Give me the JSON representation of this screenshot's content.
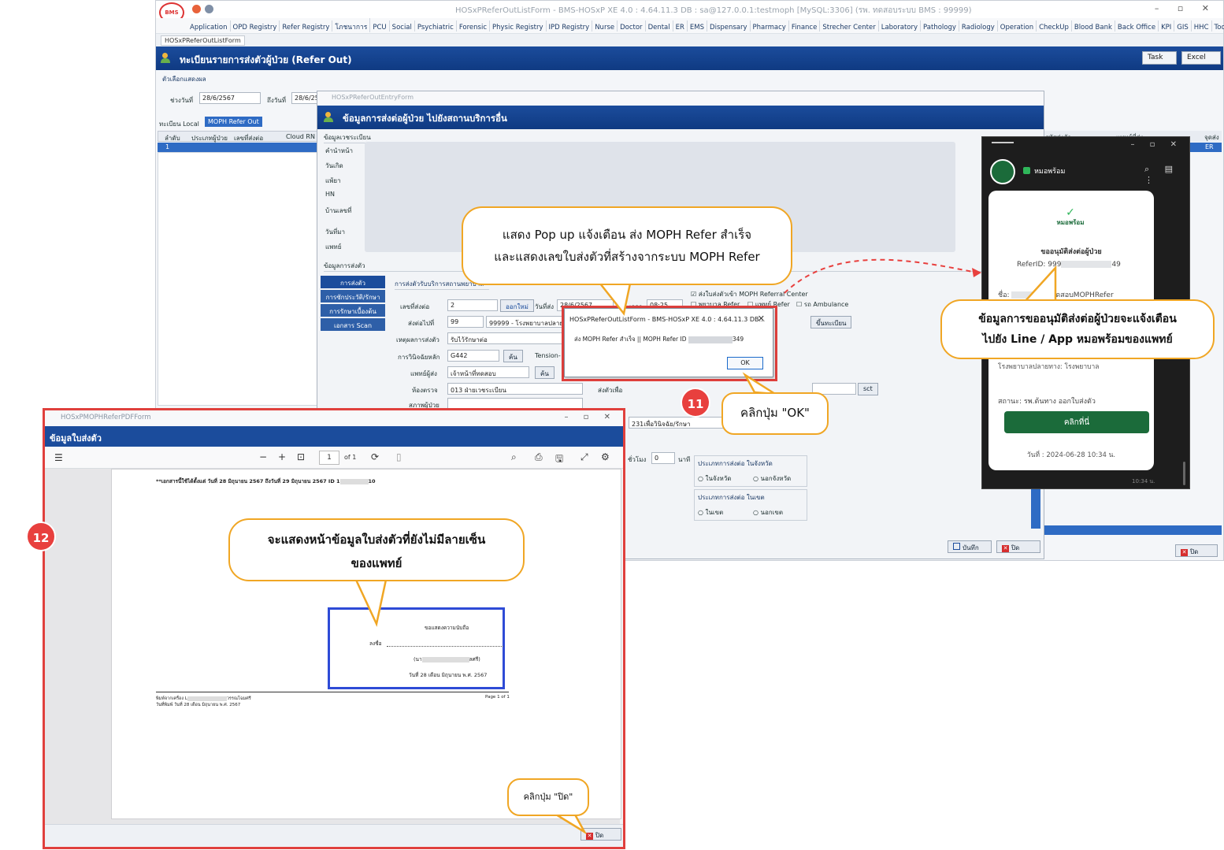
{
  "main_window": {
    "title": "HOSxPReferOutListForm - BMS-HOSxP XE 4.0 : 4.64.11.3 DB : sa@127.0.0.1:testmoph [MySQL:3306] (รพ. ทดสอบระบบ BMS : 99999)",
    "window_controls": "– ▫ ✕",
    "menu": [
      "Application",
      "OPD Registry",
      "Refer Registry",
      "โภชนาการ",
      "PCU",
      "Social",
      "Psychiatric",
      "Forensic",
      "Physic Registry",
      "IPD Registry",
      "Nurse",
      "Doctor",
      "Dental",
      "ER",
      "EMS",
      "Dispensary",
      "Pharmacy",
      "Finance",
      "Strecher Center",
      "Laboratory",
      "Pathology",
      "Radiology",
      "Operation",
      "CheckUp",
      "Blood Bank",
      "Back Office",
      "KPI",
      "GIS",
      "HHC",
      "Tools"
    ],
    "doc_tab": "HOSxPReferOutListForm",
    "header_title": "ทะเบียนรายการส่งตัวผู้ป่วย (Refer Out)",
    "task_button": "Task",
    "excel_button": "Excel",
    "filter_label": "ตัวเลือกแสดงผล",
    "date_from_label": "ช่วงวันที่",
    "date_from_value": "28/6/2567",
    "date_to_label": "ถึงวันที่",
    "date_to_value": "28/6/25",
    "tabs": [
      "ทะเบียน Local",
      "MOPH Refer Out"
    ],
    "grid_headers": [
      "ลำดับ",
      "ประเภทผู้ป่วย",
      "เลขที่ส่งต่อ",
      "Cloud RN"
    ],
    "grid_row_index": "1",
    "right_grid_headers": [
      "รหัสส่งตัว",
      "แพทย์ที่ส่ง",
      "จุดส่ง"
    ],
    "right_grid_value": "ER",
    "close_button": "ปิด"
  },
  "entry_window": {
    "title": "HOSxPReferOutEntryForm",
    "header_title": "ข้อมูลการส่งต่อผู้ป่วย ไปยังสถานบริการอื่น",
    "patient_section": "ข้อมูลเวชระเบียน",
    "patient_labels": [
      "คำนำหน้า",
      "วันเกิด",
      "แพ้ยา",
      "HN",
      "บ้านเลขที่",
      "วันที่มา",
      "แพทย์"
    ],
    "refer_section": "ข้อมูลการส่งตัว",
    "side_tabs": [
      "การส่งตัว",
      "การซักประวัติ/รักษา",
      "การรักษาเบื้องต้น",
      "เอกสาร Scan"
    ],
    "sub_section": "การส่งตัวรับบริการสถานพยาบาล",
    "refer_no_label": "เลขที่ส่งต่อ",
    "refer_no_value": "2",
    "new_button": "ออกใหม่",
    "send_date_label": "วันที่ส่ง",
    "send_date_value": "28/6/2567",
    "time_label": "เวลา",
    "time_value": "08:25",
    "dest_label": "ส่งต่อไปที่",
    "dest_code": "99",
    "dest_name": "99999 - โรงพยาบาลปลายทาง",
    "register_button": "ขึ้นทะเบียน",
    "reason_label": "เหตุผลการส่งตัว",
    "reason_value": "รับไว้รักษาต่อ",
    "dx_label": "การวินิจฉัยหลัก",
    "dx_value": "G442",
    "search_button": "ค้น",
    "dx_name": "Tension-",
    "doctor_label": "แพทย์ผู้ส่ง",
    "doctor_value": "เจ้าหน้าที่ทดสอบ",
    "room_label": "ห้องตรวจ",
    "room_value": "013 ฝ่ายเวชระเบียน",
    "status_label": "สภาพผู้ป่วย",
    "send_for_label": "ส่งตัวเพื่อ",
    "send_for_value": "231เพื่อวินิจฉัย/รักษา",
    "sct_button": "sct",
    "chk_moph": "ส่งใบส่งตัวเข้า MOPH Referral Center",
    "chk_nurse": "พยาบาล Refer",
    "chk_doctor": "แพทย์ Refer",
    "chk_ambulance": "รถ Ambulance",
    "hours_label": "ชั่วโมง",
    "hours_value": "0",
    "minutes_label": "นาที",
    "province_group": "ประเภทการส่งต่อ ในจังหวัด",
    "province_in": "ในจังหวัด",
    "province_out": "นอกจังหวัด",
    "zone_group": "ประเภทการส่งต่อ ในเขต",
    "zone_in": "ในเขต",
    "zone_out": "นอกเขต",
    "save_button": "บันทึก",
    "close_button": "ปิด"
  },
  "message_box": {
    "title": "HOSxPReferOutListForm - BMS-HOSxP XE 4.0 : 4.64.11.3 DB...",
    "body": "ส่ง MOPH Refer สำเร็จ || MOPH Refer ID",
    "body_suffix": "349",
    "ok": "OK"
  },
  "phone": {
    "app_name": "หมอพร้อม",
    "logo_text": "หมอพร้อม",
    "card_title": "ขออนุมัติส่งต่อผู้ป่วย",
    "refer_id_prefix": "ReferID: 999",
    "refer_id_suffix": "49",
    "name_prefix": "ชื่อ: ",
    "name_suffix": "ทดสอบMOPHRefer",
    "hospital_line": "โรงพยาบาลปลายทาง: โรงพยาบาล",
    "status_line": "สถานะ: รพ.ต้นทาง ออกใบส่งตัว",
    "button": "คลิกที่นี่",
    "date_line": "วันที่ : 2024-06-28 10:34 น.",
    "time": "10:34 น."
  },
  "pdf_window": {
    "title": "HOSxPMOPHReferPDFForm",
    "header_title": "ข้อมูลใบส่งตัว",
    "page_current": "1",
    "page_total": "of 1",
    "doc_line": "**เอกสารนี้ใช้ได้ตั้งแต่ วันที่   28 มิถุนายน 2567   ถึงวันที่   29 มิถุนายน 2567   ID   1",
    "doc_line_suffix": "10",
    "sign_title": "ขอแสดงความนับถือ",
    "sign_label": "ลงชื่อ",
    "sign_paren_open": "(นา",
    "sign_paren_close": "ลศรี)",
    "sign_date": "วันที่ 28 เดือน มิถุนายน พ.ศ. 2567",
    "footer_left_1": "พิมพ์จากเครื่อง L",
    "footer_left_1b": "วรรณโฉมศรี",
    "footer_left_2": "วันที่พิมพ์ วันที่ 28 เดือน มิถุนายน พ.ศ. 2567",
    "footer_right": "Page 1 of 1",
    "close_button": "ปิด"
  },
  "callouts": {
    "popup": "แสดง Pop up แจ้งเตือน ส่ง MOPH Refer สำเร็จ\nและแสดงเลขใบส่งตัวที่สร้างจากระบบ MOPH Refer",
    "line": "ข้อมูลการขออนุมัติส่งต่อผู้ป่วยจะแจ้งเตือน\nไปยัง Line / App หมอพร้อมของแพทย์",
    "click_ok": "คลิกปุ่ม \"OK\"",
    "pdf": "จะแสดงหน้าข้อมูลใบส่งตัวที่ยังไม่มีลายเซ็น\nของแพทย์",
    "click_close": "คลิกปุ่ม \"ปิด\""
  },
  "badges": {
    "step11": "11",
    "step12": "12"
  },
  "colors": {
    "accent_red": "#e0403d",
    "callout_border": "#f0a624",
    "header_blue": "#1b4c9c",
    "line_green": "#1b6b3a"
  }
}
